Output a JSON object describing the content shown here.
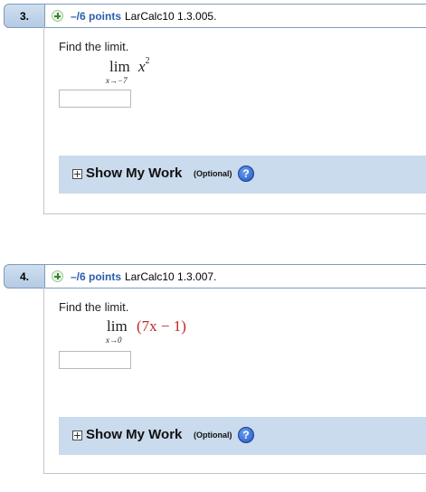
{
  "questions": [
    {
      "number": "3.",
      "points": "–/6 points",
      "code": "LarCalc10 1.3.005.",
      "prompt": "Find the limit.",
      "limit_word": "lim",
      "limit_sub": "x→−7",
      "expression_base": "x",
      "expression_exp": "2",
      "answer_value": "",
      "show_work_label": "Show My Work",
      "optional_label": "(Optional)",
      "help_icon": "?"
    },
    {
      "number": "4.",
      "points": "–/6 points",
      "code": "LarCalc10 1.3.007.",
      "prompt": "Find the limit.",
      "limit_word": "lim",
      "limit_sub": "x→0",
      "expression": "(7x − 1)",
      "answer_value": "",
      "show_work_label": "Show My Work",
      "optional_label": "(Optional)",
      "help_icon": "?"
    }
  ],
  "colors": {
    "header_blue": "#b4cbe3",
    "points_blue": "#2a5db0",
    "work_bar": "#c9dbec",
    "expression_red": "#c0282a"
  },
  "icons": [
    "add-points-icon",
    "expand-icon",
    "help-icon"
  ]
}
